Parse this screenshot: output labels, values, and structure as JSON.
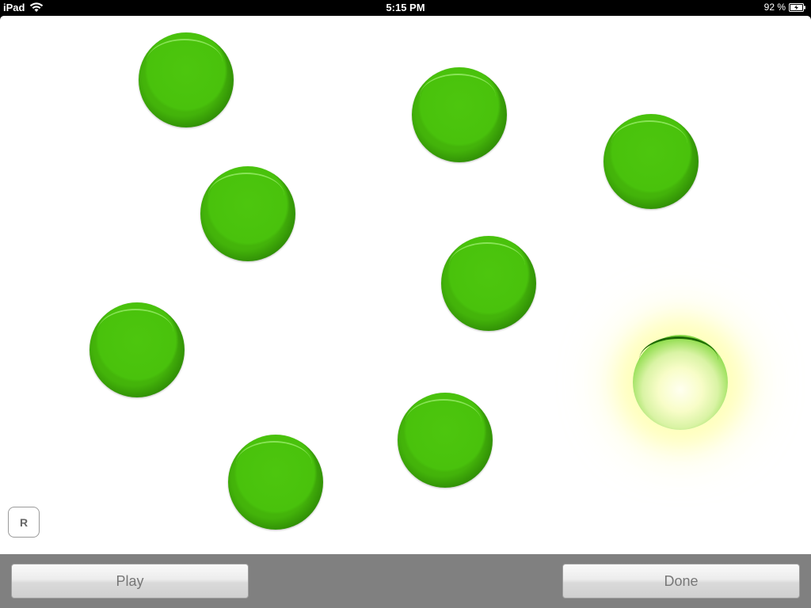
{
  "status_bar": {
    "device": "iPad",
    "time": "5:15 PM",
    "battery": "92 %",
    "icons": [
      "wifi-icon",
      "battery-charging-icon"
    ]
  },
  "canvas": {
    "dot_count": 9,
    "dot_color": "#4ac20c",
    "selected_glow_color": "#ffffb4",
    "selected_dot_index": 8,
    "r_button_label": "R"
  },
  "bottom_bar": {
    "background": "#808080",
    "play_label": "Play",
    "done_label": "Done"
  }
}
